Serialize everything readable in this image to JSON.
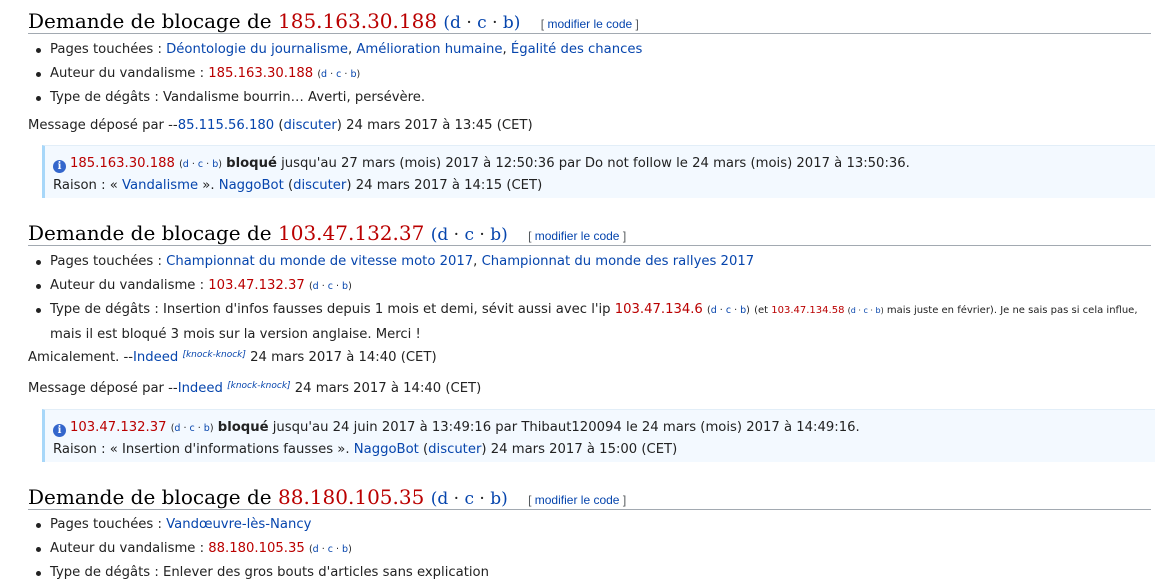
{
  "common": {
    "heading_prefix": "Demande de blocage de",
    "d": "d",
    "c": "c",
    "b": "b",
    "sep": "·",
    "edit_label": "modifier le code",
    "lb_open": "[",
    "lb_close": "]",
    "label_pages": "Pages touchées :",
    "label_author": "Auteur du vandalisme :",
    "label_damage": "Type de dégâts :",
    "msg_prefix": "Message déposé par --",
    "open_paren": "(",
    "discuter": "discuter",
    "close_paren": ")",
    "blocked_word": "bloqué",
    "reason_prefix": "Raison : « ",
    "reason_suffix": " ».",
    "bot": "NaggoBot",
    "knock": "[knock-knock]",
    "comma": ","
  },
  "sections": [
    {
      "ip": "185.163.30.188",
      "pages": [
        "Déontologie du journalisme",
        "Amélioration humaine",
        "Égalité des chances"
      ],
      "damage": "Vandalisme bourrin… Averti, persévère.",
      "msg_user": "85.115.56.180",
      "msg_date": "24 mars 2017 à 13:45 (CET)",
      "block_text": "jusqu'au 27 mars (mois) 2017 à 12:50:36 par Do not follow le 24 mars (mois) 2017 à 13:50:36.",
      "reason": "Vandalisme",
      "reason_date": "24 mars 2017 à 14:15 (CET)"
    },
    {
      "ip": "103.47.132.37",
      "pages": [
        "Championnat du monde de vitesse moto 2017",
        "Championnat du monde des rallyes 2017"
      ],
      "damage_a": "Insertion d'infos fausses depuis 1 mois et demi, sévit aussi avec l'ip",
      "damage_ip": "103.47.134.6",
      "damage_et": "(et",
      "damage_ip2": "103.47.134.58",
      "damage_b": "mais juste en février). Je ne sais pas si cela influe,",
      "damage_c": "mais il est bloqué 3 mois sur la version anglaise. Merci !",
      "amic": "Amicalement. --",
      "amic_user": "Indeed",
      "amic_date": "24 mars 2017 à 14:40 (CET)",
      "msg_user": "Indeed",
      "msg_date": "24 mars 2017 à 14:40 (CET)",
      "block_text": "jusqu'au 24 juin 2017 à 13:49:16 par Thibaut120094 le 24 mars (mois) 2017 à 14:49:16.",
      "reason": "Insertion d'informations fausses",
      "reason_date": "24 mars 2017 à 15:00 (CET)"
    },
    {
      "ip": "88.180.105.35",
      "pages": [
        "Vandœuvre-lès-Nancy"
      ],
      "damage": "Enlever des gros bouts d'articles sans explication"
    }
  ]
}
